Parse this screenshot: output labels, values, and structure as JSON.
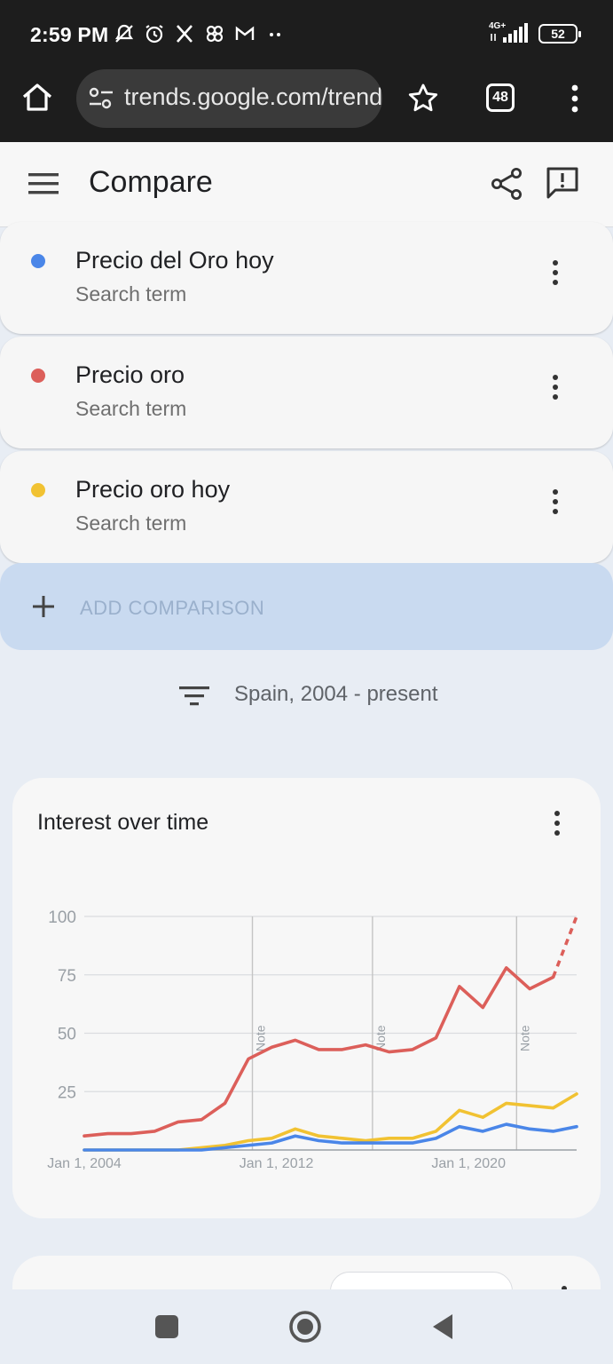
{
  "status_bar": {
    "time": "2:59 PM",
    "network": "4G+",
    "battery": "52",
    "icons": [
      "bell-off-icon",
      "alarm-icon",
      "x-icon",
      "pinwheel-icon",
      "gmail-icon",
      "more-dots-icon"
    ]
  },
  "browser": {
    "url": "trends.google.com/trends",
    "tab_count": "48"
  },
  "header": {
    "title": "Compare"
  },
  "terms": [
    {
      "label": "Precio del Oro hoy",
      "sub": "Search term",
      "color": "#4a86e8"
    },
    {
      "label": "Precio oro",
      "sub": "Search term",
      "color": "#dc5f5a"
    },
    {
      "label": "Precio oro hoy",
      "sub": "Search term",
      "color": "#f1c232"
    }
  ],
  "add_comparison": {
    "label": "ADD COMPARISON"
  },
  "filter": {
    "text": "Spain, 2004 - present"
  },
  "chart_card": {
    "title": "Interest over time"
  },
  "chart_data": {
    "type": "line",
    "title": "Interest over time",
    "x_tick_labels": [
      "Jan 1, 2004",
      "Jan 1, 2012",
      "Jan 1, 2020"
    ],
    "y_tick_labels": [
      "100",
      "75",
      "50",
      "25"
    ],
    "ylim": [
      0,
      100
    ],
    "xlim": [
      2004,
      2024.5
    ],
    "annotations": [
      {
        "x": 2011,
        "text": "Note"
      },
      {
        "x": 2016,
        "text": "Note"
      },
      {
        "x": 2022,
        "text": "Note"
      }
    ],
    "x": [
      2004,
      2005,
      2006,
      2007,
      2008,
      2009,
      2010,
      2011,
      2012,
      2013,
      2014,
      2015,
      2016,
      2017,
      2018,
      2019,
      2020,
      2021,
      2022,
      2023,
      2024
    ],
    "series": [
      {
        "name": "Precio del Oro hoy",
        "color": "#4a86e8",
        "values": [
          0,
          0,
          0,
          0,
          0,
          0,
          1,
          2,
          3,
          6,
          4,
          3,
          3,
          3,
          3,
          5,
          10,
          8,
          11,
          9,
          8,
          10
        ]
      },
      {
        "name": "Precio oro",
        "color": "#dc5f5a",
        "values": [
          6,
          7,
          7,
          8,
          12,
          13,
          20,
          39,
          44,
          47,
          43,
          43,
          45,
          42,
          43,
          48,
          70,
          61,
          78,
          69,
          74,
          100
        ],
        "partial_from_index": 20
      },
      {
        "name": "Precio oro hoy",
        "color": "#f1c232",
        "values": [
          0,
          0,
          0,
          0,
          0,
          1,
          2,
          4,
          5,
          9,
          6,
          5,
          4,
          5,
          5,
          8,
          17,
          14,
          20,
          19,
          18,
          24
        ]
      }
    ]
  },
  "nav": {
    "buttons": [
      "recents-button",
      "home-button",
      "back-button"
    ]
  }
}
